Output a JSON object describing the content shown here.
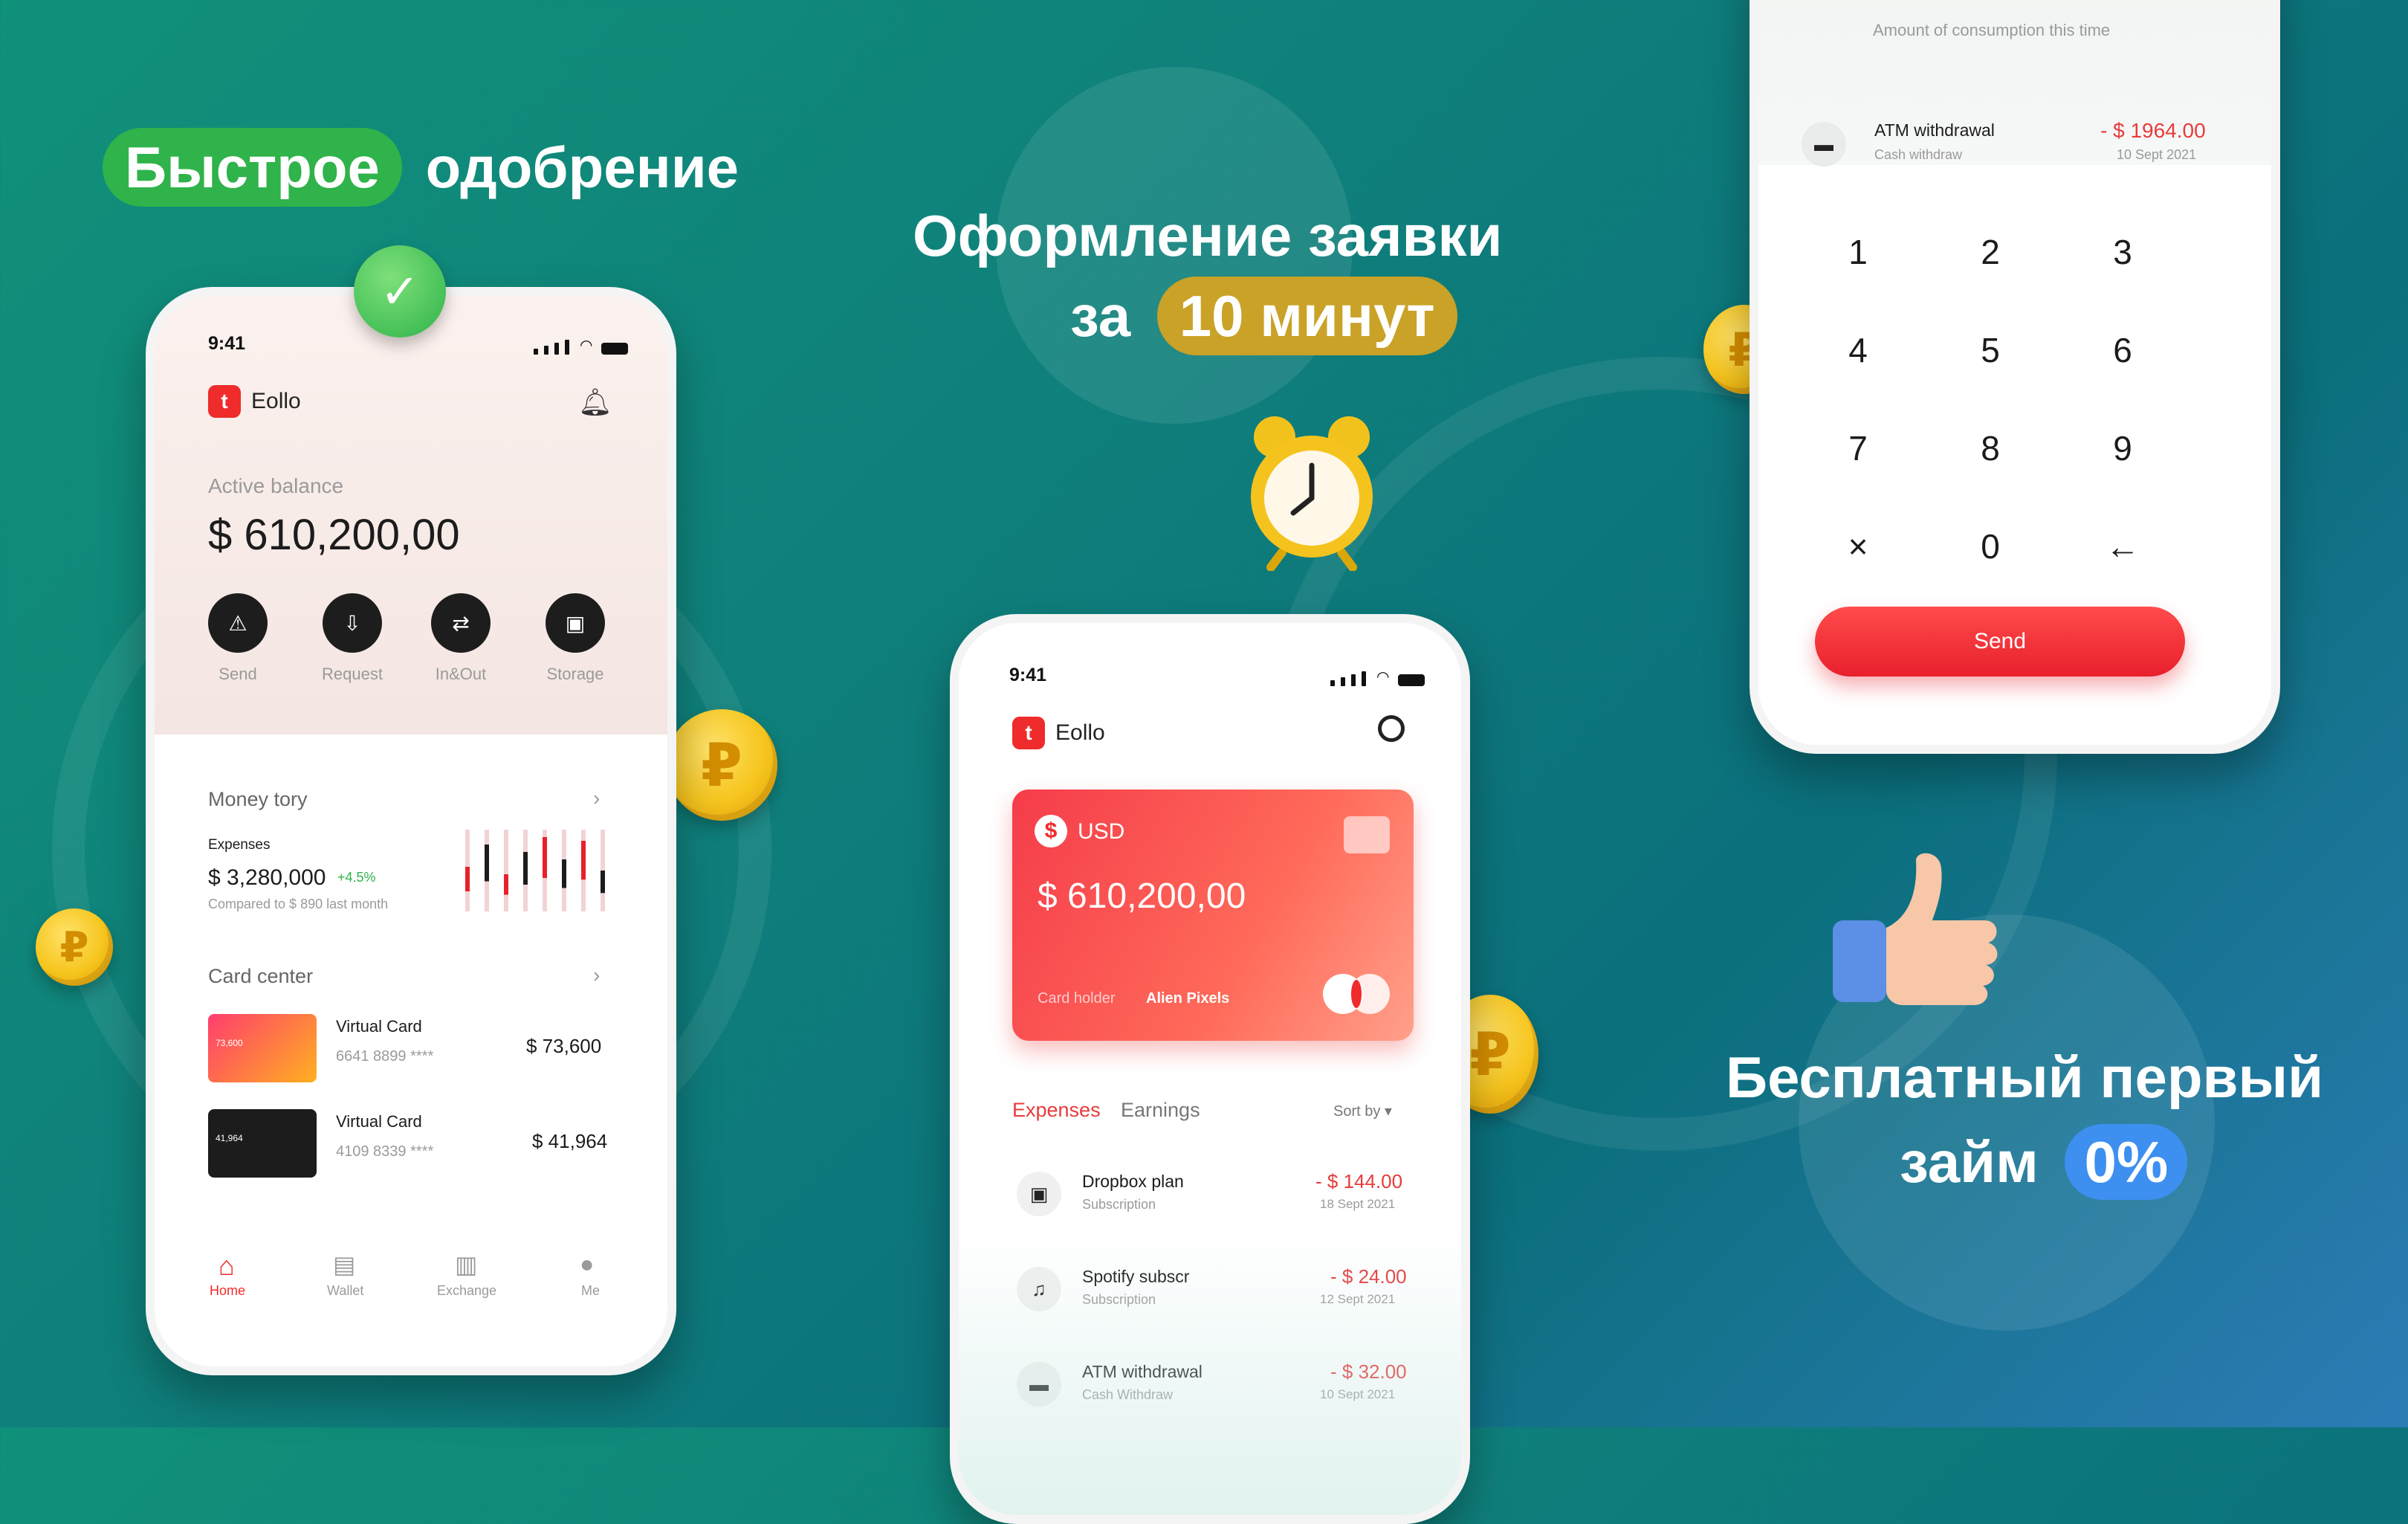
{
  "headline1": {
    "highlight": "Быстрое",
    "rest": "одобрение",
    "highlight_color": "#2fb34a"
  },
  "headline2": {
    "line1": "Оформление заявки",
    "line2_prefix": "за",
    "highlight": "10 минут",
    "highlight_color": "#c9a227"
  },
  "headline3": {
    "line1": "Бесплатный первый",
    "line2_prefix": "займ",
    "highlight": "0%",
    "highlight_color": "#3d8ff0"
  },
  "coin_symbol": "₽",
  "phone1": {
    "time": "9:41",
    "brand": "Eollo",
    "logo_letter": "t",
    "balance_label": "Active balance",
    "balance": "$ 610,200,00",
    "actions": [
      "Send",
      "Request",
      "In&Out",
      "Storage"
    ],
    "money_title": "Money tory",
    "expenses_label": "Expenses",
    "expenses_value": "$ 3,280,000",
    "expenses_delta": "+4.5%",
    "expenses_compare": "Compared to $ 890 last month",
    "card_center": "Card center",
    "cards": [
      {
        "name": "Virtual Card",
        "number": "6641 8899 ****",
        "amount": "$ 73,600",
        "thumb": "73,600"
      },
      {
        "name": "Virtual Card",
        "number": "4109 8339 ****",
        "amount": "$ 41,964",
        "thumb": "41,964"
      }
    ],
    "nav": [
      "Home",
      "Wallet",
      "Exchange",
      "Me"
    ]
  },
  "phone2": {
    "time": "9:41",
    "brand": "Eollo",
    "logo_letter": "t",
    "currency": "USD",
    "card_balance": "$ 610,200,00",
    "holder_label": "Card holder",
    "holder_name": "Alien Pixels",
    "tab_active": "Expenses",
    "tab_other": "Earnings",
    "sort_label": "Sort by",
    "transactions": [
      {
        "title": "Dropbox plan",
        "sub": "Subscription",
        "amount": "- $ 144.00",
        "date": "18 Sept 2021"
      },
      {
        "title": "Spotify subscr",
        "sub": "Subscription",
        "amount": "- $ 24.00",
        "date": "12 Sept 2021"
      },
      {
        "title": "ATM withdrawal",
        "sub": "Cash Withdraw",
        "amount": "- $ 32.00",
        "date": "10 Sept 2021"
      }
    ]
  },
  "phone3": {
    "consumption_label": "Amount of consumption this time",
    "tx": {
      "title": "ATM withdrawal",
      "sub": "Cash withdraw",
      "amount": "- $ 1964.00",
      "date": "10 Sept 2021"
    },
    "keys": [
      "1",
      "2",
      "3",
      "4",
      "5",
      "6",
      "7",
      "8",
      "9",
      "×",
      "0",
      "←"
    ],
    "send_label": "Send"
  },
  "colors": {
    "accent_red": "#ef2b2b",
    "bg_top": "#10917a",
    "bg_bottom": "#2c7cb6"
  }
}
